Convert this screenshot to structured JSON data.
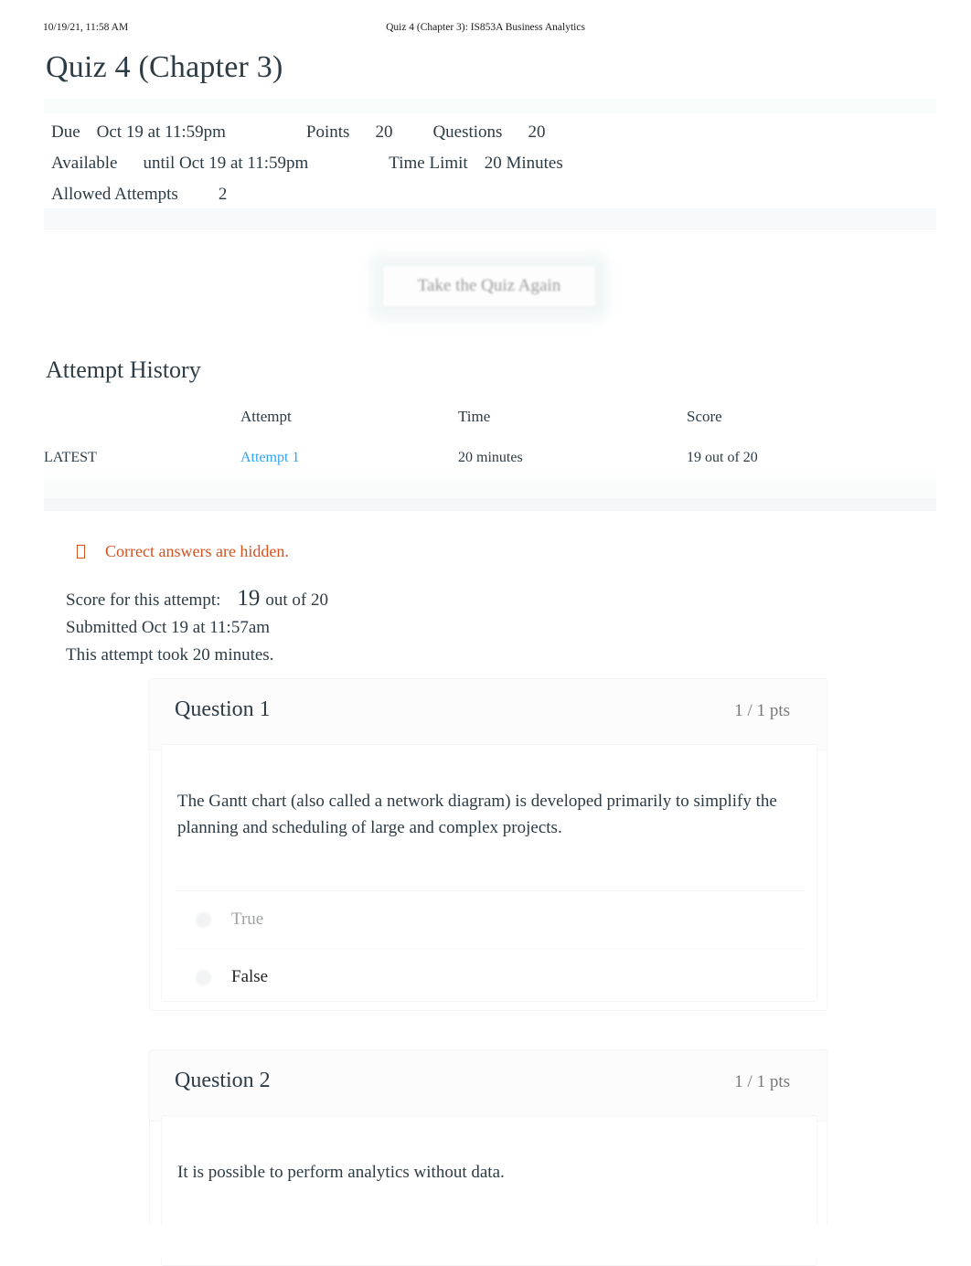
{
  "print_header": {
    "date": "10/19/21, 11:58 AM",
    "document_title": "Quiz 4 (Chapter 3): IS853A Business Analytics"
  },
  "page_title": "Quiz 4 (Chapter 3)",
  "quiz_meta": {
    "due_label": "Due",
    "due_value": "Oct 19 at 11:59pm",
    "points_label": "Points",
    "points_value": "20",
    "questions_label": "Questions",
    "questions_value": "20",
    "available_label": "Available",
    "available_value": "until Oct 19 at 11:59pm",
    "time_limit_label": "Time Limit",
    "time_limit_value": "20 Minutes",
    "allowed_attempts_label": "Allowed Attempts",
    "allowed_attempts_value": "2"
  },
  "actions": {
    "take_quiz_again": "Take the Quiz Again"
  },
  "attempt_history": {
    "heading": "Attempt History",
    "columns": [
      "",
      "Attempt",
      "Time",
      "Score"
    ],
    "rows": [
      {
        "kept": "LATEST",
        "attempt": "Attempt 1",
        "time": "20 minutes",
        "score": "19 out of 20"
      }
    ]
  },
  "notice": {
    "icon": "warning-tofu-icon",
    "text": "Correct answers are hidden."
  },
  "score_summary": {
    "label": "Score for this attempt:",
    "score": "19",
    "out_of": "out of 20",
    "submitted": "Submitted Oct 19 at 11:57am",
    "duration": "This attempt took 20 minutes."
  },
  "questions": [
    {
      "name": "Question 1",
      "points": "1 / 1 pts",
      "text": "The Gantt chart (also called a network diagram) is developed primarily to simplify the planning and scheduling of large and complex projects.",
      "answers": [
        {
          "label": "True",
          "selected": false
        },
        {
          "label": "False",
          "selected": true
        }
      ]
    },
    {
      "name": "Question 2",
      "points": "1 / 1 pts",
      "text": "It is possible to perform analytics without data.",
      "answers": []
    }
  ],
  "colors": {
    "link": "#2ea3f2",
    "notice": "#d4511e",
    "text": "#2d3b45",
    "muted": "#9fa1a3"
  }
}
